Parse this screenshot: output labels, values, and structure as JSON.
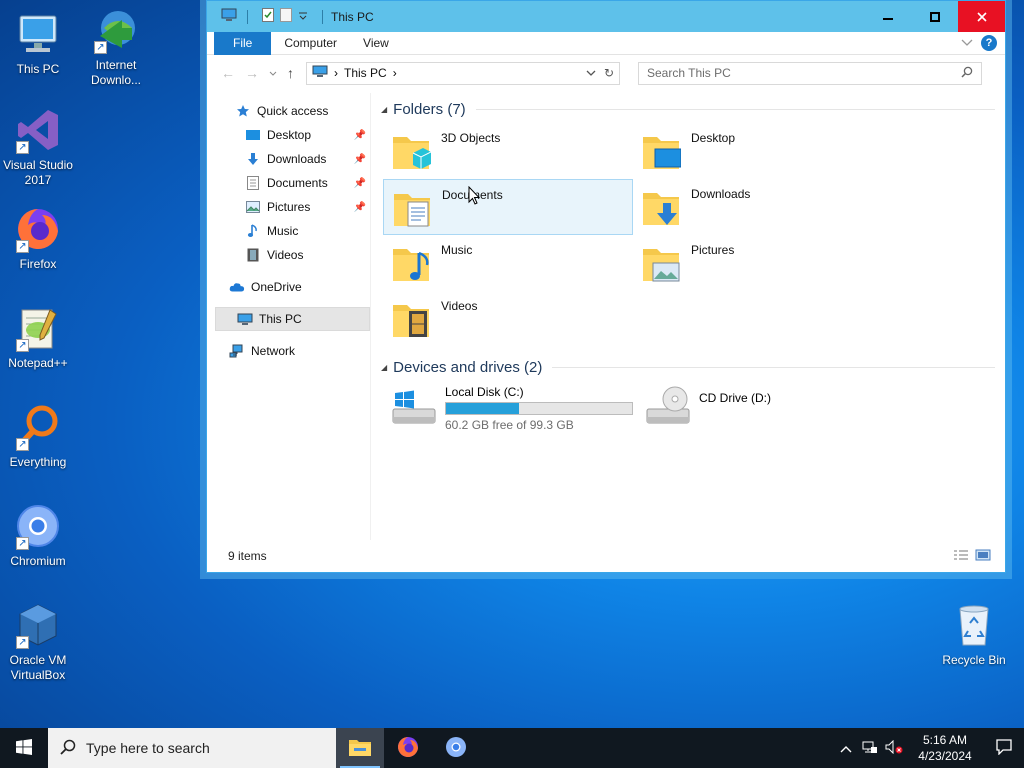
{
  "desktop": {
    "icons": [
      {
        "label": "This PC"
      },
      {
        "label": "Internet Downlo..."
      },
      {
        "label": "Visual Studio 2017"
      },
      {
        "label": "Firefox"
      },
      {
        "label": "Notepad++"
      },
      {
        "label": "Everything"
      },
      {
        "label": "Chromium"
      },
      {
        "label": "Oracle VM VirtualBox"
      },
      {
        "label": "Recycle Bin"
      }
    ]
  },
  "window": {
    "title": "This PC",
    "ribbon_tabs": [
      "File",
      "Computer",
      "View"
    ],
    "help": "?",
    "address": {
      "location": "This PC"
    },
    "search": {
      "placeholder": "Search This PC"
    },
    "nav_pane": {
      "quick_access": "Quick access",
      "items": [
        "Desktop",
        "Downloads",
        "Documents",
        "Pictures",
        "Music",
        "Videos"
      ],
      "onedrive": "OneDrive",
      "this_pc": "This PC",
      "network": "Network"
    },
    "groups": {
      "folders_header": "Folders (7)",
      "folders": [
        "3D Objects",
        "Desktop",
        "Documents",
        "Downloads",
        "Music",
        "Pictures",
        "Videos"
      ],
      "devices_header": "Devices and drives (2)",
      "drives": [
        {
          "name": "Local Disk (C:)",
          "free_text": "60.2 GB free of 99.3 GB",
          "used_fraction": 0.394
        },
        {
          "name": "CD Drive (D:)"
        }
      ]
    },
    "status": {
      "items": "9 items"
    }
  },
  "taskbar": {
    "search_placeholder": "Type here to search",
    "time": "5:16 AM",
    "date": "4/23/2024"
  },
  "colors": {
    "accent": "#1979ca",
    "titlebar": "#5ec1ea",
    "close": "#e81123",
    "drive_bar": "#26a0da"
  }
}
